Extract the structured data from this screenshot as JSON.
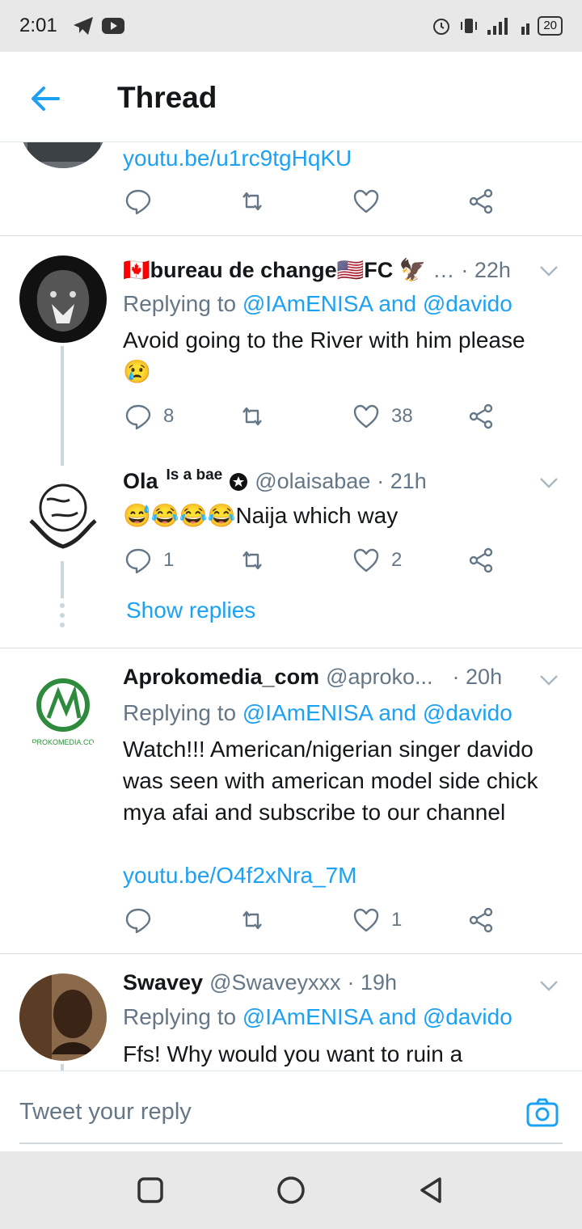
{
  "status": {
    "time": "2:01",
    "battery": "20"
  },
  "header": {
    "title": "Thread"
  },
  "top_tweet": {
    "link": "youtu.be/u1rc9tgHqKU"
  },
  "tweets": [
    {
      "name": "🇨🇦bureau de change🇺🇸FC 🦅",
      "ellipsis": "…",
      "time": "· 22h",
      "replying_prefix": "Replying to",
      "replying_to": "@IAmENISA and @davido",
      "text": "Avoid going to the River with him please 😢",
      "replies": "8",
      "likes": "38"
    },
    {
      "name": "Ola",
      "name_suffix": "Is a bae",
      "handle": "@olaisabae",
      "time": "· 21h",
      "text": "😅😂😂😂Naija which way",
      "replies": "1",
      "likes": "2"
    },
    {
      "name": "Aprokomedia_com",
      "handle": "@aproko...",
      "time": "· 20h",
      "replying_prefix": "Replying to",
      "replying_to": "@IAmENISA and @davido",
      "text": "Watch!!! American/nigerian singer davido was seen with american model side chick mya afai and subscribe to our channel",
      "link": "youtu.be/O4f2xNra_7M",
      "likes": "1",
      "avatar_text": "PROKOMEDIA.CO"
    },
    {
      "name": "Swavey",
      "handle": "@Swaveyxxx",
      "time": "· 19h",
      "replying_prefix": "Replying to",
      "replying_to": "@IAmENISA and @davido",
      "text": "Ffs! Why would you want to ruin a"
    }
  ],
  "show_replies": "Show replies",
  "composer": {
    "placeholder": "Tweet your reply"
  },
  "colors": {
    "accent": "#1da1f2",
    "muted": "#657786",
    "text": "#14171a"
  }
}
